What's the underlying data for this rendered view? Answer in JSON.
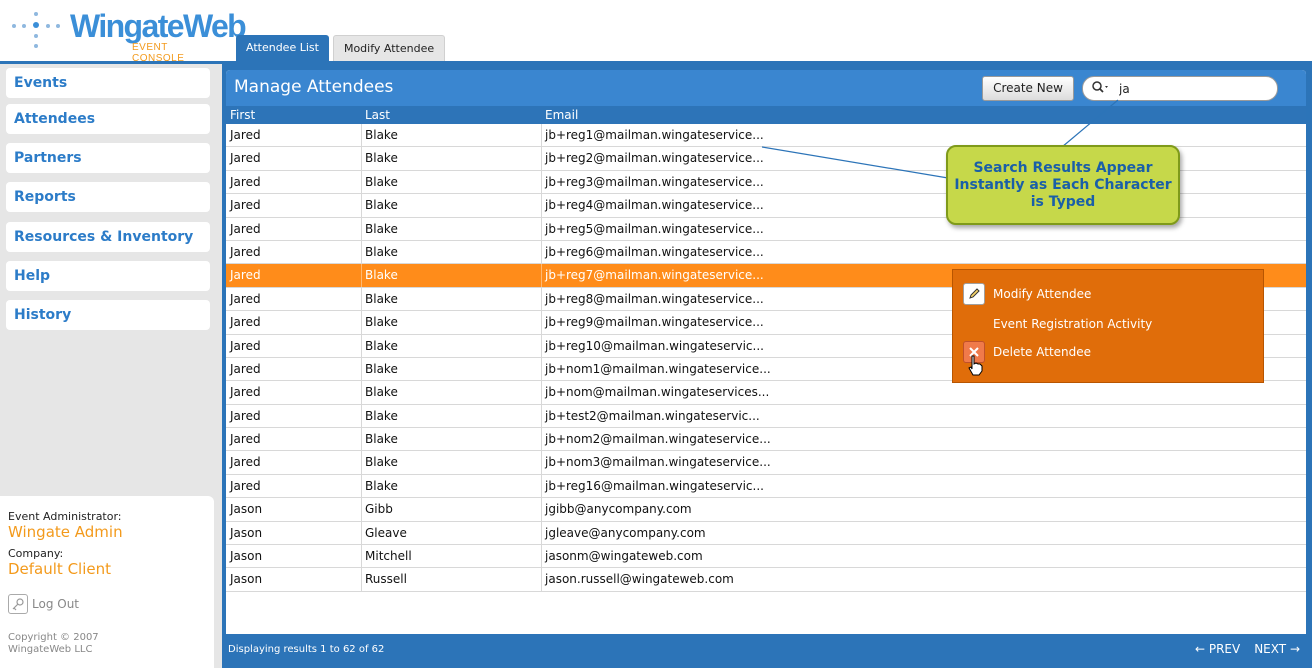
{
  "brand": {
    "name": "WingateWeb",
    "subtitle": "EVENT CONSOLE"
  },
  "tabs": [
    {
      "label": "Attendee List",
      "active": true
    },
    {
      "label": "Modify Attendee",
      "active": false
    }
  ],
  "sidebar": {
    "items": [
      {
        "label": "Events"
      },
      {
        "label": "Attendees"
      },
      {
        "label": "Partners"
      },
      {
        "label": "Reports"
      },
      {
        "label": "Resources & Inventory"
      },
      {
        "label": "Help"
      },
      {
        "label": "History"
      }
    ],
    "admin_label": "Event Administrator:",
    "admin_name": "Wingate Admin",
    "company_label": "Company:",
    "company_name": "Default Client",
    "logout_label": "Log Out",
    "copyright_line1": "Copyright © 2007",
    "copyright_line2": "WingateWeb LLC"
  },
  "main": {
    "title": "Manage Attendees",
    "create_label": "Create New",
    "search_value": "ja",
    "columns": [
      "First",
      "Last",
      "Email"
    ],
    "rows": [
      [
        "Jared",
        "Blake",
        "jb+reg1@mailman.wingateservice..."
      ],
      [
        "Jared",
        "Blake",
        "jb+reg2@mailman.wingateservice..."
      ],
      [
        "Jared",
        "Blake",
        "jb+reg3@mailman.wingateservice..."
      ],
      [
        "Jared",
        "Blake",
        "jb+reg4@mailman.wingateservice..."
      ],
      [
        "Jared",
        "Blake",
        "jb+reg5@mailman.wingateservice..."
      ],
      [
        "Jared",
        "Blake",
        "jb+reg6@mailman.wingateservice..."
      ],
      [
        "Jared",
        "Blake",
        "jb+reg7@mailman.wingateservice..."
      ],
      [
        "Jared",
        "Blake",
        "jb+reg8@mailman.wingateservice..."
      ],
      [
        "Jared",
        "Blake",
        "jb+reg9@mailman.wingateservice..."
      ],
      [
        "Jared",
        "Blake",
        "jb+reg10@mailman.wingateservic..."
      ],
      [
        "Jared",
        "Blake",
        "jb+nom1@mailman.wingateservice..."
      ],
      [
        "Jared",
        "Blake",
        "jb+nom@mailman.wingateservices..."
      ],
      [
        "Jared",
        "Blake",
        "jb+test2@mailman.wingateservic..."
      ],
      [
        "Jared",
        "Blake",
        "jb+nom2@mailman.wingateservice..."
      ],
      [
        "Jared",
        "Blake",
        "jb+nom3@mailman.wingateservice..."
      ],
      [
        "Jared",
        "Blake",
        "jb+reg16@mailman.wingateservic..."
      ],
      [
        "Jason",
        "Gibb",
        "jgibb@anycompany.com"
      ],
      [
        "Jason",
        "Gleave",
        "jgleave@anycompany.com"
      ],
      [
        "Jason",
        "Mitchell",
        "jasonm@wingateweb.com"
      ],
      [
        "Jason",
        "Russell",
        "jason.russell@wingateweb.com"
      ]
    ],
    "selected_row": 6,
    "footer_text": "Displaying results 1 to 62 of 62",
    "prev_label": "PREV",
    "next_label": "NEXT"
  },
  "context_menu": {
    "items": [
      {
        "label": "Modify Attendee",
        "icon": "pencil-icon"
      },
      {
        "label": "Event Registration Activity",
        "icon": ""
      },
      {
        "label": "Delete Attendee",
        "icon": "delete-x-icon"
      }
    ]
  },
  "callout": {
    "text": "Search Results Appear Instantly as Each Character is Typed"
  },
  "colors": {
    "header_blue": "#2c74b8",
    "accent_orange": "#ff8c1a",
    "menu_orange": "#e06d0a",
    "callout_green": "#c6d84a",
    "link_blue": "#2c7cc8"
  }
}
